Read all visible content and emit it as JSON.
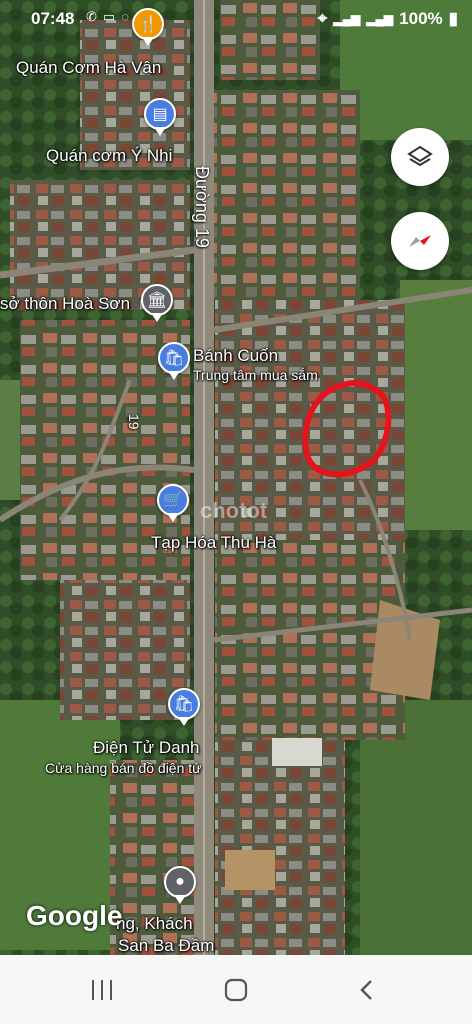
{
  "status_bar": {
    "time": "07:48",
    "battery": "100%",
    "icons": [
      "viber-icon",
      "zalo-icon",
      "messenger-icon",
      "location-icon",
      "signal-icon",
      "signal-icon",
      "battery-icon"
    ]
  },
  "road": {
    "name": "Đường 19",
    "minor_label": "19"
  },
  "places": [
    {
      "name": "Quán Cơm Hà Vân",
      "icon": "restaurant-icon",
      "color": "#f29900"
    },
    {
      "name": "Quán cơm Ý Nhi",
      "icon": "hotel-icon",
      "color": "#4a7de0"
    },
    {
      "name": "sở thôn Hoà Sơn",
      "icon": "government-building-icon",
      "color": "#5f6368"
    },
    {
      "name": "Bánh Cuốn",
      "subtitle": "Trung tâm mua sắm",
      "icon": "shopping-bag-icon",
      "color": "#4a7de0"
    },
    {
      "name": "Tạp Hóa Thu Hà",
      "icon": "shopping-cart-icon",
      "color": "#4a7de0"
    },
    {
      "name": "Điện Tử Danh",
      "subtitle": "Cửa hàng bán đồ điện tử",
      "icon": "shopping-bag-icon",
      "color": "#4a7de0"
    },
    {
      "name": "Nhà Hàng, Khách San Ba Đầm",
      "line1": "ng, Khách",
      "line2": "San Ba Đầm",
      "icon": "place-pin-icon",
      "color": "#5f6368"
    }
  ],
  "map_controls": {
    "layers": "layers-icon",
    "compass": "compass-icon"
  },
  "attribution": "Google",
  "watermark": "chotot",
  "annotation": {
    "shape": "red-hand-drawn-circle",
    "color": "#e4141c"
  },
  "nav_bar": {
    "buttons": [
      "recent-apps-icon",
      "home-icon",
      "back-icon"
    ]
  }
}
